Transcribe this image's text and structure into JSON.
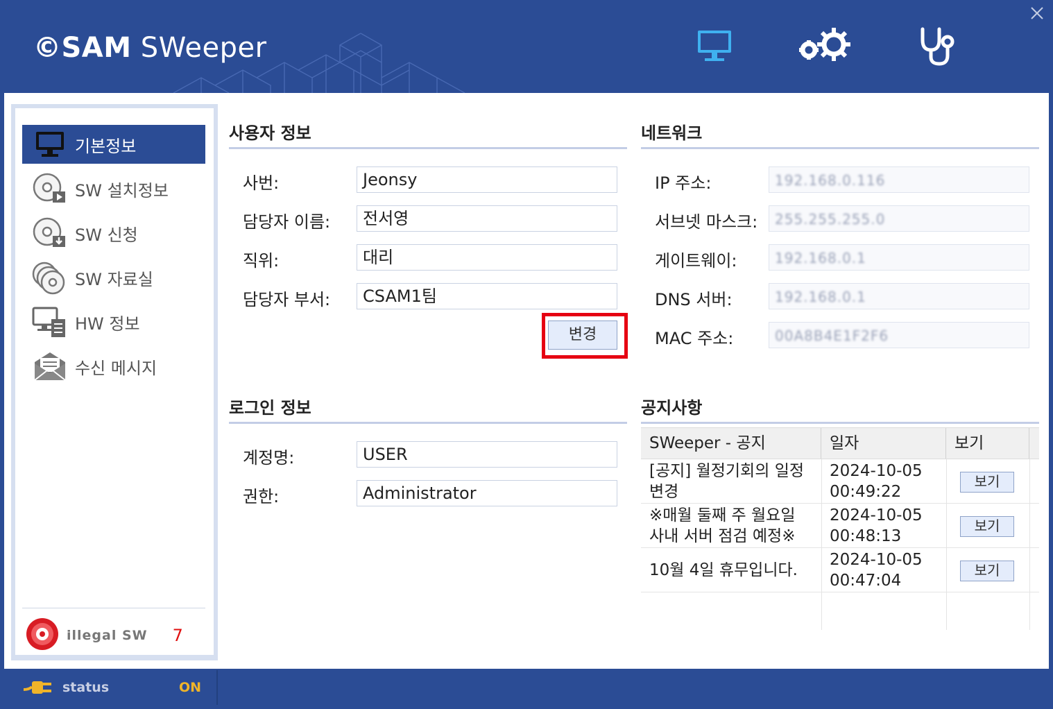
{
  "app": {
    "logo_prefix": "©SAM",
    "logo_suffix": "SWeeper"
  },
  "header_icons": [
    "monitor-icon",
    "settings-gear-icon",
    "stethoscope-icon",
    "close-icon"
  ],
  "sidebar": {
    "items": [
      {
        "label": "기본정보",
        "icon": "monitor-icon",
        "active": true
      },
      {
        "label": "SW 설치정보",
        "icon": "disc-play-icon"
      },
      {
        "label": "SW 신청",
        "icon": "disc-download-icon"
      },
      {
        "label": "SW 자료실",
        "icon": "discs-stack-icon"
      },
      {
        "label": "HW 정보",
        "icon": "hardware-icon"
      },
      {
        "label": "수신 메시지",
        "icon": "envelope-icon"
      }
    ],
    "illegal": {
      "label": "illegal SW",
      "count": "7",
      "icon": "illegal-disc-icon"
    }
  },
  "user_info": {
    "title": "사용자 정보",
    "fields": [
      {
        "label": "사번:",
        "value": "Jeonsy"
      },
      {
        "label": "담당자 이름:",
        "value": "전서영"
      },
      {
        "label": "직위:",
        "value": "대리"
      },
      {
        "label": "담당자 부서:",
        "value": "CSAM1팀"
      }
    ],
    "change_button": "변경"
  },
  "network": {
    "title": "네트워크",
    "fields": [
      {
        "label": "IP 주소:",
        "value": "192.168.0.116"
      },
      {
        "label": "서브넷 마스크:",
        "value": "255.255.255.0"
      },
      {
        "label": "게이트웨이:",
        "value": "192.168.0.1"
      },
      {
        "label": "DNS 서버:",
        "value": "192.168.0.1"
      },
      {
        "label": "MAC 주소:",
        "value": "00A8B4E1F2F6"
      }
    ]
  },
  "login_info": {
    "title": "로그인 정보",
    "fields": [
      {
        "label": "계정명:",
        "value": "USER"
      },
      {
        "label": "권한:",
        "value": "Administrator"
      }
    ]
  },
  "notices": {
    "title": "공지사항",
    "columns": [
      "SWeeper - 공지",
      "일자",
      "보기"
    ],
    "rows": [
      {
        "title": "[공지] 월정기회의 일정 변경",
        "date": "2024-10-05",
        "time": "00:49:22",
        "action": "보기"
      },
      {
        "title": "※매월 둘째 주 월요일 사내 서버 점검 예정※",
        "date": "2024-10-05",
        "time": "00:48:13",
        "action": "보기"
      },
      {
        "title": "10월 4일 휴무입니다.",
        "date": "2024-10-05",
        "time": "00:47:04",
        "action": "보기"
      }
    ]
  },
  "status": {
    "label": "status",
    "value": "ON",
    "icon": "plug-icon"
  },
  "colors": {
    "brand": "#2b4c95",
    "highlight": "#e60012",
    "status_on": "#f0b429",
    "illegal_count": "#e01010"
  }
}
